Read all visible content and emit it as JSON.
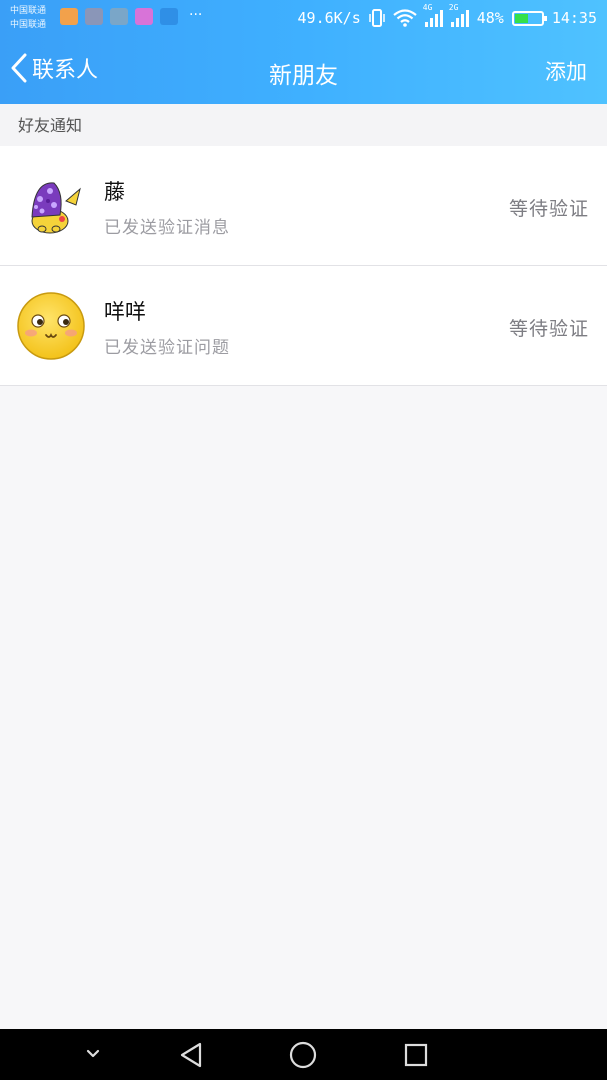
{
  "status_bar": {
    "carrier_1": "中国联通",
    "carrier_2": "中国联通",
    "more": "···",
    "speed": "49.6K/s",
    "net_4g": "4G",
    "net_2g": "2G",
    "battery": "48%",
    "time": "14:35"
  },
  "nav": {
    "back_label": "联系人",
    "title": "新朋友",
    "add_label": "添加"
  },
  "section": {
    "title": "好友通知"
  },
  "requests": [
    {
      "name": "藤",
      "message": "已发送验证消息",
      "status": "等待验证"
    },
    {
      "name": "咩咩",
      "message": "已发送验证问题",
      "status": "等待验证"
    }
  ],
  "colors": {
    "header_start": "#3a9ff7",
    "header_end": "#4fc2ff",
    "background": "#f7f7f9"
  },
  "icons": [
    "back-chevron-icon",
    "vibrate-icon",
    "wifi-icon",
    "signal-icon",
    "battery-icon",
    "nav-down-icon",
    "nav-back-icon",
    "nav-home-icon",
    "nav-recent-icon"
  ]
}
